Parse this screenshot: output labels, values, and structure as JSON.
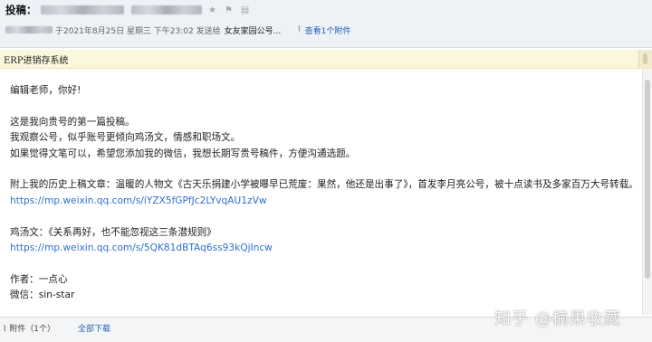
{
  "header": {
    "subject_label": "投稿：",
    "meta_date": "于2021年8月25日 星期三 下午23:02 发送给",
    "recipient": "女友家园公号...",
    "attachment_link": "查看1个附件",
    "icons": [
      "star-icon",
      "flag-icon",
      "print-icon"
    ]
  },
  "banner": {
    "title": "ERP进销存系统"
  },
  "email_body": {
    "greeting": "编辑老师，你好!",
    "intro_1": "这是我向贵号的第一篇投稿。",
    "intro_2": "我观察公号，似乎账号更倾向鸡汤文，情感和职场文。",
    "intro_3": "如果觉得文笔可以，希望您添加我的微信，我想长期写贵号稿件，方便沟通选题。",
    "history": "附上我的历史上稿文章：温暖的人物文《古天乐捐建小学被曝早已荒废：果然，他还是出事了》，首发李月亮公号，被十点读书及多家百万大号转载。",
    "link_1": "https://mp.weixin.qq.com/s/iYZX5fGPfJc2LYvqAU1zVw",
    "chicken_soup": "鸡汤文：《关系再好，也不能忽视这三条潜规则》",
    "link_2": "https://mp.weixin.qq.com/s/5QK81dBTAq6ss93kQjIncw",
    "author": "作者：一点心",
    "wechat": "微信：sin-star"
  },
  "footer": {
    "attachment_label": "附件（1个）",
    "download_all": "全部下载"
  },
  "watermark": "知乎 @楠果收藏",
  "colors": {
    "link": "#2f6fd0",
    "header_bg": "#eef1f5",
    "banner_bg": "#fbf7dd"
  }
}
